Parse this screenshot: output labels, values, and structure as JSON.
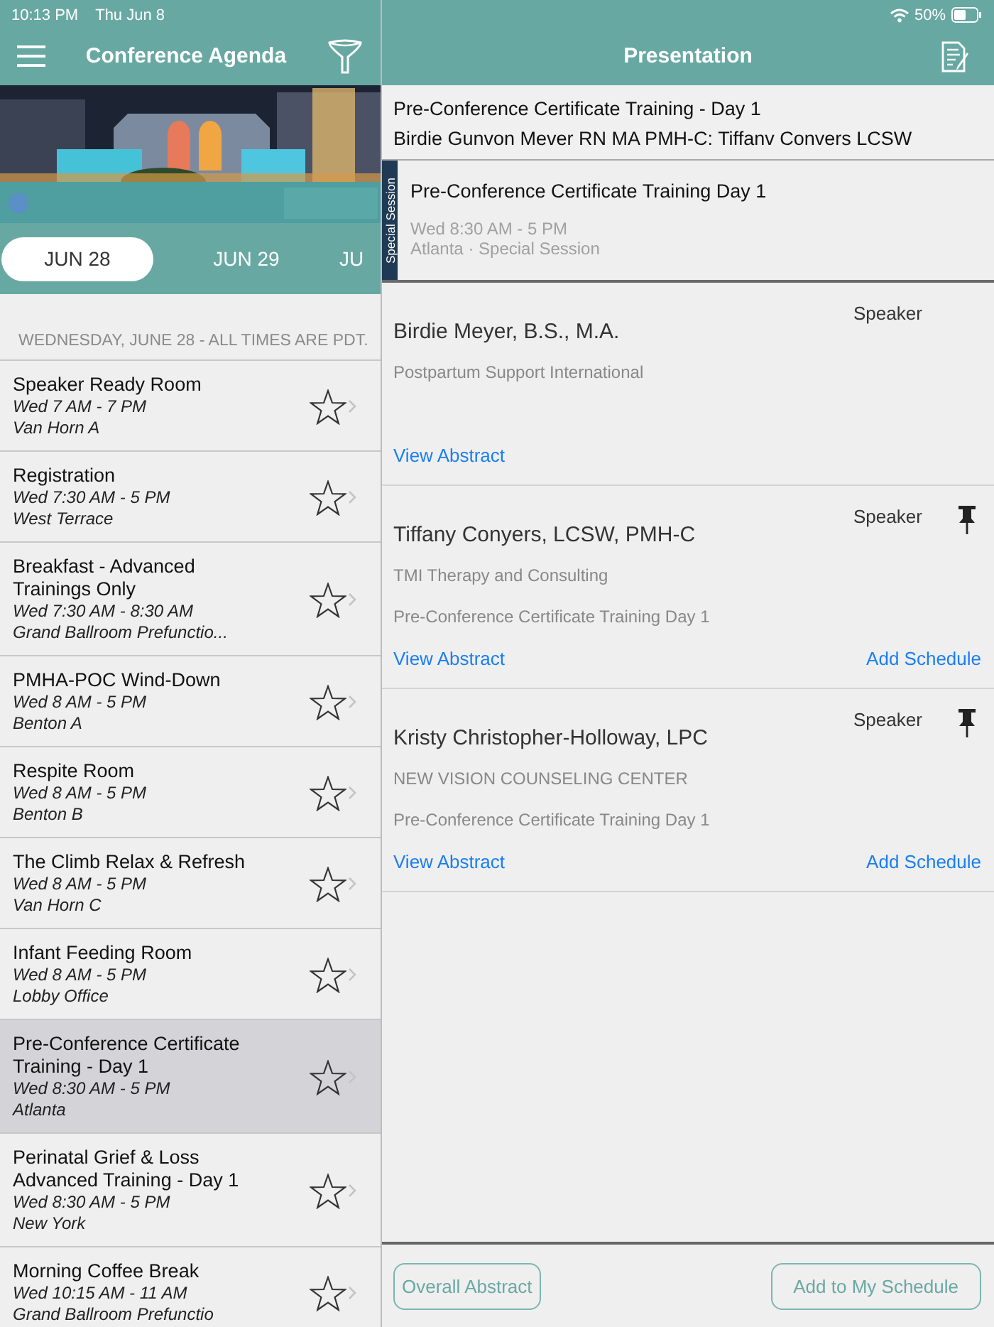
{
  "status_bar": {
    "time": "10:13 PM",
    "date": "Thu Jun 8",
    "battery": "50%"
  },
  "agenda": {
    "title": "Conference Agenda",
    "date_tabs": [
      {
        "label": "JUN 28",
        "selected": true
      },
      {
        "label": "JUN 29",
        "selected": false
      },
      {
        "label": "JU",
        "selected": false
      }
    ],
    "section_header": "WEDNESDAY, JUNE 28 - ALL TIMES ARE PDT.",
    "sessions": [
      {
        "title": "Speaker Ready Room",
        "time": "Wed 7 AM - 7 PM",
        "location": "Van Horn A",
        "starred": false,
        "selected": false
      },
      {
        "title": "Registration",
        "time": "Wed 7:30 AM - 5 PM",
        "location": "West Terrace",
        "starred": false,
        "selected": false
      },
      {
        "title": "Breakfast - Advanced Trainings Only",
        "time": "Wed 7:30 AM - 8:30 AM",
        "location": "Grand Ballroom Prefunctio...",
        "starred": false,
        "selected": false
      },
      {
        "title": "PMHA-POC Wind-Down",
        "time": "Wed 8 AM - 5 PM",
        "location": "Benton A",
        "starred": false,
        "selected": false
      },
      {
        "title": "Respite Room",
        "time": "Wed 8 AM - 5 PM",
        "location": "Benton B",
        "starred": false,
        "selected": false
      },
      {
        "title": "The Climb Relax & Refresh",
        "time": "Wed 8 AM - 5 PM",
        "location": "Van Horn C",
        "starred": false,
        "selected": false
      },
      {
        "title": "Infant Feeding Room",
        "time": "Wed 8 AM - 5 PM",
        "location": "Lobby Office",
        "starred": false,
        "selected": false
      },
      {
        "title": "Pre-Conference Certificate Training - Day 1",
        "time": "Wed 8:30 AM - 5 PM",
        "location": "Atlanta",
        "starred": false,
        "selected": true
      },
      {
        "title": "Perinatal Grief & Loss Advanced Training - Day 1",
        "time": "Wed 8:30 AM - 5 PM",
        "location": "New York",
        "starred": false,
        "selected": false
      },
      {
        "title": "Morning Coffee Break",
        "time": "Wed 10:15 AM - 11 AM",
        "location": "Grand Ballroom Prefunctio",
        "starred": false,
        "selected": false
      }
    ]
  },
  "presentation": {
    "title": "Presentation",
    "heading": "Pre-Conference Certificate Training - Day 1",
    "subheading": "Birdie Gunvon Mever RN MA PMH-C: Tiffanv Convers LCSW",
    "session": {
      "tag": "Special Session",
      "title": "Pre-Conference Certificate Training Day 1",
      "time": "Wed 8:30 AM - 5 PM",
      "location": "Atlanta · Special Session"
    },
    "speakers": [
      {
        "name": "Birdie Meyer, B.S., M.A.",
        "role": "Speaker",
        "organization": "Postpartum Support International",
        "pinned": false,
        "view_abstract": "View Abstract"
      },
      {
        "name": "Tiffany Conyers, LCSW, PMH-C",
        "role": "Speaker",
        "organization": "TMI Therapy and Consulting",
        "session": "Pre-Conference Certificate Training Day 1",
        "pinned": true,
        "view_abstract": "View Abstract",
        "add_schedule": "Add Schedule"
      },
      {
        "name": "Kristy Christopher-Holloway, LPC",
        "role": "Speaker",
        "organization": "NEW VISION COUNSELING CENTER",
        "session": "Pre-Conference Certificate Training Day 1",
        "pinned": true,
        "view_abstract": "View Abstract",
        "add_schedule": "Add Schedule"
      }
    ],
    "buttons": [
      "Overall Abstract",
      "Add to My Schedule"
    ]
  }
}
